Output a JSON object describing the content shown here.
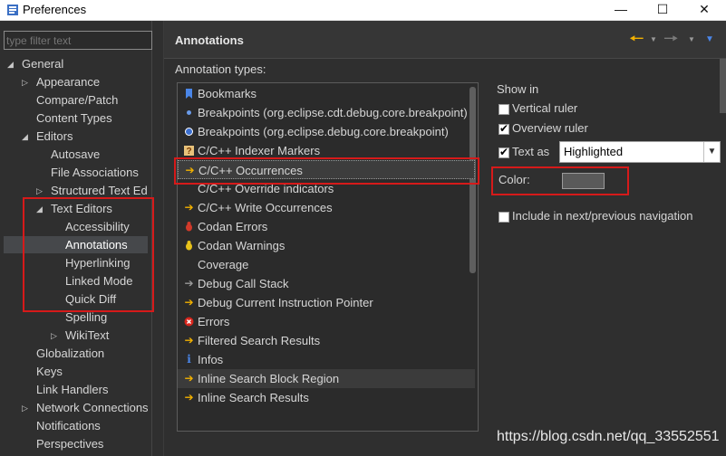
{
  "window": {
    "title": "Preferences",
    "minimize": "—",
    "maximize": "☐",
    "close": "✕"
  },
  "filter": {
    "placeholder": "type filter text"
  },
  "tree": [
    {
      "label": "General",
      "expanded": true
    },
    {
      "label": "Appearance",
      "expanded": false
    },
    {
      "label": "Compare/Patch"
    },
    {
      "label": "Content Types"
    },
    {
      "label": "Editors",
      "expanded": true
    },
    {
      "label": "Autosave"
    },
    {
      "label": "File Associations"
    },
    {
      "label": "Structured Text Ed",
      "expanded": false
    },
    {
      "label": "Text Editors",
      "expanded": true
    },
    {
      "label": "Accessibility"
    },
    {
      "label": "Annotations",
      "selected": true
    },
    {
      "label": "Hyperlinking"
    },
    {
      "label": "Linked Mode"
    },
    {
      "label": "Quick Diff"
    },
    {
      "label": "Spelling"
    },
    {
      "label": "WikiText",
      "expanded": false
    },
    {
      "label": "Globalization"
    },
    {
      "label": "Keys"
    },
    {
      "label": "Link Handlers"
    },
    {
      "label": "Network Connections",
      "expanded": false
    },
    {
      "label": "Notifications"
    },
    {
      "label": "Perspectives"
    }
  ],
  "page": {
    "title": "Annotations",
    "annotation_types_label": "Annotation types:"
  },
  "annotation_types": [
    {
      "label": "Bookmarks",
      "icon": "bookmark-icon"
    },
    {
      "label": "Breakpoints (org.eclipse.cdt.debug.core.breakpoint)",
      "icon": "breakpoint-icon"
    },
    {
      "label": "Breakpoints (org.eclipse.debug.core.breakpoint)",
      "icon": "breakpoint-icon"
    },
    {
      "label": "C/C++ Indexer Markers",
      "icon": "help-marker-icon"
    },
    {
      "label": "C/C++ Occurrences",
      "icon": "arrow-right-icon",
      "selected": true
    },
    {
      "label": "C/C++ Override indicators",
      "icon": ""
    },
    {
      "label": "C/C++ Write Occurrences",
      "icon": "arrow-right-icon"
    },
    {
      "label": "Codan Errors",
      "icon": "bug-red-icon"
    },
    {
      "label": "Codan Warnings",
      "icon": "bug-yellow-icon"
    },
    {
      "label": "Coverage",
      "icon": ""
    },
    {
      "label": "Debug Call Stack",
      "icon": "arrow-right-gray-icon"
    },
    {
      "label": "Debug Current Instruction Pointer",
      "icon": "arrow-right-icon"
    },
    {
      "label": "Errors",
      "icon": "error-icon"
    },
    {
      "label": "Filtered Search Results",
      "icon": "arrow-right-icon"
    },
    {
      "label": "Infos",
      "icon": "info-icon"
    },
    {
      "label": "Inline Search Block Region",
      "icon": "arrow-right-icon",
      "highlighted": true
    },
    {
      "label": "Inline Search Results",
      "icon": "arrow-right-icon"
    }
  ],
  "options": {
    "show_in": "Show in",
    "vertical_ruler": "Vertical ruler",
    "vertical_ruler_checked": false,
    "overview_ruler": "Overview ruler",
    "overview_ruler_checked": true,
    "text_as": "Text as",
    "text_as_checked": true,
    "text_as_value": "Highlighted",
    "color_label": "Color:",
    "color_value": "#5a5a5a",
    "include_nav": "Include in next/previous navigation",
    "include_nav_checked": false
  },
  "colors": {
    "accent_back": "#f2b100",
    "annotation_highlight": "#d61a1a"
  },
  "watermark": "https://blog.csdn.net/qq_33552551"
}
